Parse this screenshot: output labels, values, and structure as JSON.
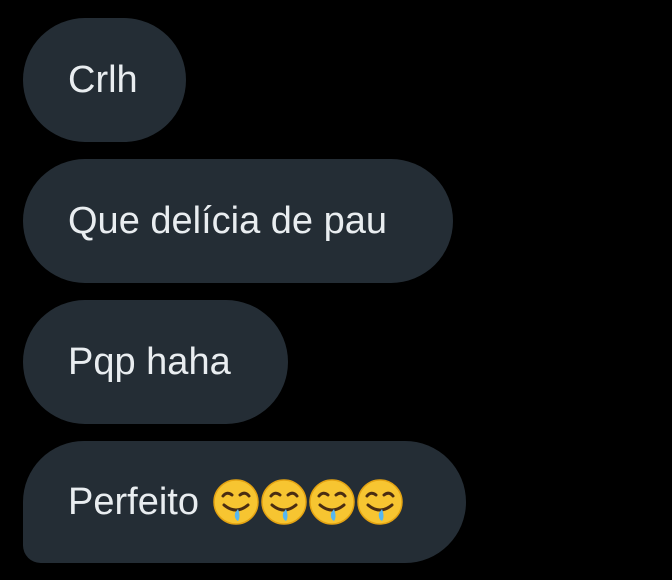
{
  "messages": [
    {
      "text": "Crlh"
    },
    {
      "text": "Que delícia de pau"
    },
    {
      "text": "Pqp haha"
    },
    {
      "text": "Perfeito",
      "emojis": [
        "drooling-face",
        "drooling-face",
        "drooling-face",
        "drooling-face"
      ]
    }
  ],
  "colors": {
    "background": "#000000",
    "bubble": "#242d35",
    "text": "#e9edf0"
  }
}
